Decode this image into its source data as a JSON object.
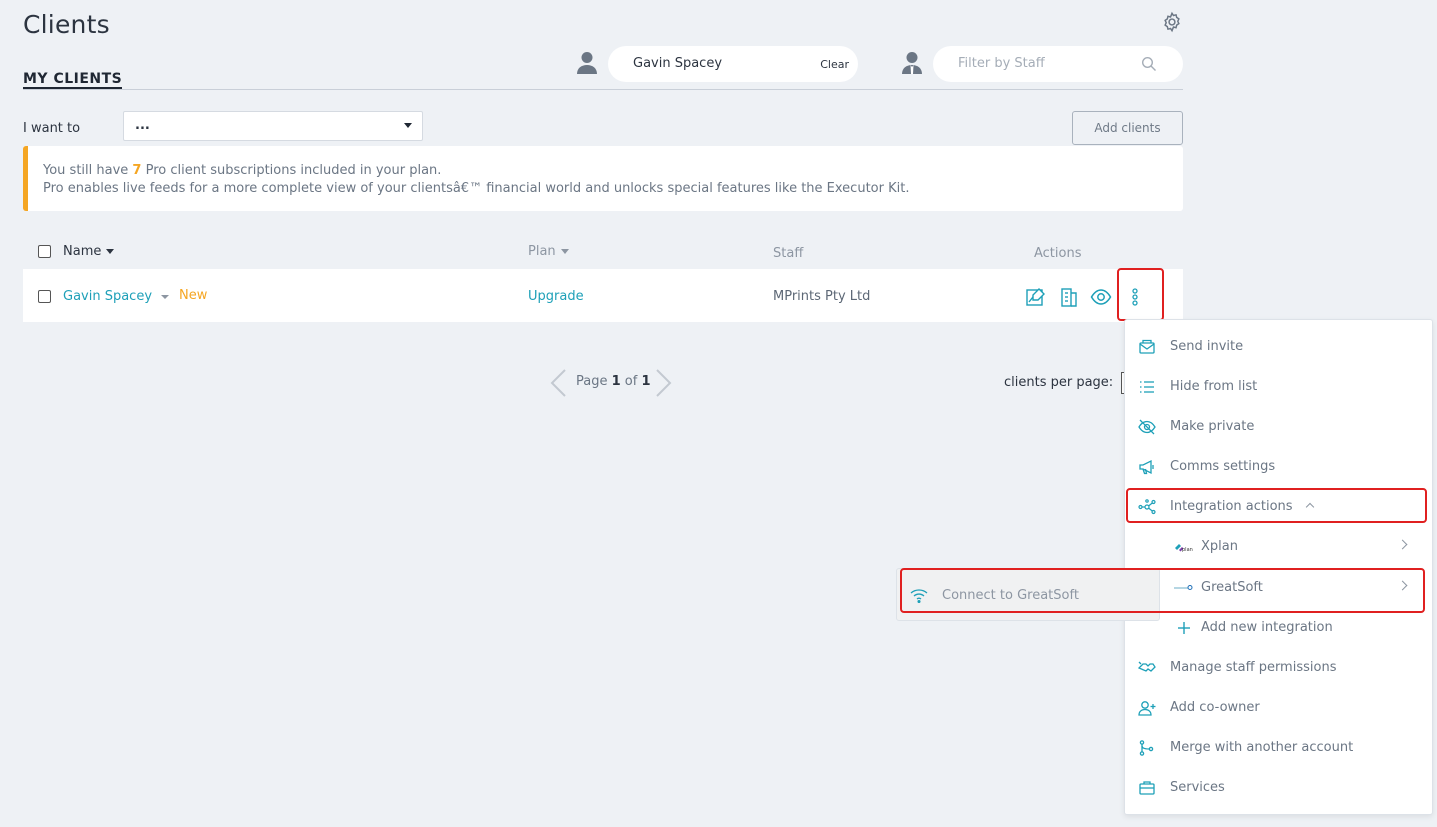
{
  "page": {
    "title": "Clients"
  },
  "tabs": [
    {
      "label": "MY CLIENTS"
    }
  ],
  "client_filter": {
    "value": "Gavin Spacey",
    "clear_label": "Clear"
  },
  "staff_filter": {
    "placeholder": "Filter by Staff"
  },
  "i_want_to": {
    "label": "I want to",
    "selected": "..."
  },
  "add_clients_label": "Add clients",
  "notice": {
    "line1_prefix": "You still have ",
    "count": "7",
    "line1_suffix": " Pro client subscriptions included in your plan.",
    "line2": "Pro enables live feeds for a more complete view of your clientsâ€™ financial world and unlocks special features like the Executor Kit."
  },
  "table": {
    "headers": {
      "name": "Name",
      "plan": "Plan",
      "staff": "Staff",
      "actions": "Actions"
    },
    "rows": [
      {
        "name": "Gavin Spacey",
        "badge": "New",
        "plan": "Upgrade",
        "staff": "MPrints Pty Ltd"
      }
    ]
  },
  "pager": {
    "prefix": "Page ",
    "current": "1",
    "of": " of ",
    "total": "1"
  },
  "per_page_label": "clients per page:",
  "menu": {
    "items": [
      {
        "label": "Send invite",
        "icon": "send-invite-icon"
      },
      {
        "label": "Hide from list",
        "icon": "list-icon"
      },
      {
        "label": "Make private",
        "icon": "eye-slash-icon"
      },
      {
        "label": "Comms settings",
        "icon": "megaphone-icon"
      },
      {
        "label": "Integration actions",
        "icon": "integration-icon"
      },
      {
        "label": "Xplan",
        "icon": "xplan-logo-icon"
      },
      {
        "label": "GreatSoft",
        "icon": "greatsoft-logo-icon"
      },
      {
        "label": "Add new integration",
        "icon": "plus-icon"
      },
      {
        "label": "Manage staff permissions",
        "icon": "staff-permissions-icon"
      },
      {
        "label": "Add co-owner",
        "icon": "add-person-icon"
      },
      {
        "label": "Merge with another account",
        "icon": "merge-icon"
      },
      {
        "label": "Services",
        "icon": "briefcase-icon"
      }
    ]
  },
  "submenu": {
    "label": "Connect to GreatSoft",
    "icon": "wifi-icon"
  },
  "colors": {
    "accent": "#1ea0b8",
    "warning": "#f5a623",
    "highlight": "#e02020"
  }
}
